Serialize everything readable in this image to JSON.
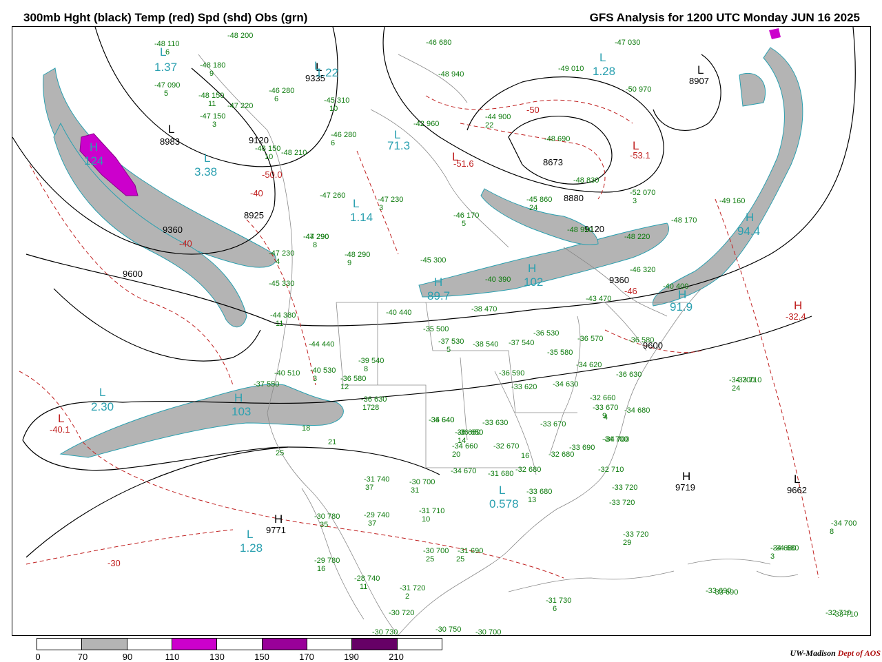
{
  "header": {
    "left_title": "300mb Hght (black) Temp (red) Spd (shd) Obs (grn)",
    "right_title": "GFS Analysis for 1200 UTC Monday  JUN 16 2025"
  },
  "legend": {
    "ticks": [
      "0",
      "70",
      "90",
      "110",
      "130",
      "150",
      "170",
      "190",
      "210"
    ],
    "colors": [
      "#ffffff",
      "#b4b4b4",
      "#ffffff",
      "#cc00cc",
      "#ffffff",
      "#990099",
      "#ffffff",
      "#660066",
      "#ffffff"
    ]
  },
  "credit": {
    "org": "UW-Madison",
    "dept": "Dept of AOS"
  },
  "height_centers": [
    {
      "type": "L",
      "value": "8983"
    },
    {
      "type": "L",
      "value": "8907"
    },
    {
      "type": "L",
      "value": "8673"
    },
    {
      "type": "L",
      "value": "8925"
    },
    {
      "type": "L",
      "value": "9335"
    },
    {
      "type": "H",
      "value": "9771"
    },
    {
      "type": "H",
      "value": "9719"
    },
    {
      "type": "L",
      "value": "9662"
    }
  ],
  "height_contours": [
    "9120",
    "9360",
    "9600",
    "9360",
    "9120",
    "8880",
    "9600",
    "9600"
  ],
  "speed_centers": [
    {
      "type": "L",
      "value": "1.37"
    },
    {
      "type": "L",
      "value": "3.38"
    },
    {
      "type": "L",
      "value": "1.14"
    },
    {
      "type": "L",
      "value": "1.28"
    },
    {
      "type": "L",
      "value": "2.30"
    },
    {
      "type": "L",
      "value": "1.28"
    },
    {
      "type": "L",
      "value": "0.578"
    },
    {
      "type": "H",
      "value": "124"
    },
    {
      "type": "H",
      "value": "103"
    },
    {
      "type": "H",
      "value": "89.7"
    },
    {
      "type": "H",
      "value": "102"
    },
    {
      "type": "H",
      "value": "94.4"
    },
    {
      "type": "H",
      "value": "91.9"
    },
    {
      "type": "L",
      "value": "71.3"
    },
    {
      "type": "L",
      "value": "1.22"
    }
  ],
  "temp_centers": [
    {
      "type": "H",
      "value": "-32.4"
    },
    {
      "type": "L",
      "value": "-40.1"
    },
    {
      "type": "L",
      "value": "-53.1"
    },
    {
      "type": "L",
      "value": "-50.0"
    },
    {
      "type": "L",
      "value": "-51.6"
    }
  ],
  "temp_contours": [
    "-30",
    "-40",
    "-50",
    "-46",
    "-40",
    "-30"
  ],
  "observations": [
    "-48 200",
    "-48 110",
    "-48 180",
    "-47 090",
    "-48 150",
    "-47 220",
    "-47 150",
    "-46 280",
    "-45 310",
    "-46 280",
    "-46 150",
    "-48 210",
    "-47 260",
    "-47 230",
    "-46 170",
    "-47 290",
    "-47 230",
    "-48 290",
    "-45 300",
    "-45 330",
    "-44 380",
    "-40 440",
    "-40 390",
    "-38 470",
    "-35 500",
    "-37 530",
    "-38 540",
    "-37 540",
    "-36 530",
    "-35 580",
    "-36 570",
    "-36 580",
    "-44 440",
    "-40 510",
    "-40 530",
    "-39 540",
    "-37 550",
    "-36 630",
    "-36 580",
    "-36 590",
    "-33 620",
    "-34 630",
    "-34 620",
    "-36 630",
    "-32 660",
    "-33 670",
    "-34 680",
    "-33 710",
    "-36 640",
    "-33 630",
    "-33 670",
    "-36 650",
    "-34 660",
    "-32 670",
    "-32 680",
    "-33 690",
    "-34 700",
    "-32 710",
    "-33 720",
    "-33 720",
    "-33 720",
    "-34 700",
    "-34 680",
    "-33 690",
    "-32 710",
    "-31 740",
    "-30 700",
    "-31 710",
    "-34 670",
    "-31 680",
    "-32 680",
    "-33 680",
    "-30 780",
    "-29 740",
    "-29 780",
    "-28 740",
    "-31 720",
    "-30 700",
    "-31 690",
    "-30 720",
    "-30 730",
    "-30 750",
    "-30 700",
    "-31 730",
    "-33 690",
    "-34 700",
    "-34 680",
    "-33 710",
    "-44 900",
    "-42 960",
    "-49 010",
    "-47 030",
    "-50 970",
    "-48 690",
    "-48 830",
    "-45 860",
    "-48 910",
    "-52 070",
    "-48 170",
    "-49 160",
    "-48 220",
    "-46 320",
    "-40 400",
    "-43 470",
    "-46 680",
    "-48 940",
    "-34 700",
    "-34 640",
    "-36 660",
    "-44 290"
  ],
  "obs_subvalues": [
    "6",
    "9",
    "5",
    "11",
    "3",
    "6",
    "10",
    "10",
    "6",
    "3",
    "5",
    "8",
    "9",
    "4",
    "11",
    "25",
    "21",
    "18",
    "37",
    "31",
    "10",
    "35",
    "37",
    "16",
    "11",
    "2",
    "25",
    "25",
    "14",
    "20",
    "28",
    "17",
    "12",
    "8",
    "3",
    "5",
    "16",
    "13",
    "24",
    "22",
    "24",
    "4",
    "9",
    "8",
    "3",
    "6",
    "29",
    "3"
  ]
}
